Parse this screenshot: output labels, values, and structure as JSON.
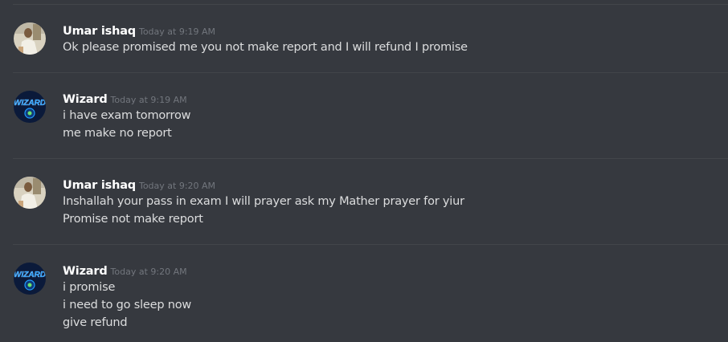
{
  "messages": [
    {
      "author": "Umar ishaq",
      "avatar_icon": "user-photo-avatar",
      "time": "Today at 9:19 AM",
      "lines": [
        "Ok please promised me you not make report and I will refund I promise"
      ]
    },
    {
      "author": "Wizard",
      "avatar_icon": "wizard-logo-avatar",
      "time": "Today at 9:19 AM",
      "lines": [
        "i have exam tomorrow",
        "me make no report"
      ]
    },
    {
      "author": "Umar ishaq",
      "avatar_icon": "user-photo-avatar",
      "time": "Today at 9:20 AM",
      "lines": [
        "Inshallah your pass in exam I will prayer ask my Mather prayer for yiur",
        "Promise not make report"
      ]
    },
    {
      "author": "Wizard",
      "avatar_icon": "wizard-logo-avatar",
      "time": "Today at 9:20 AM",
      "lines": [
        "i promise",
        "i need to go sleep now",
        "give refund"
      ]
    }
  ],
  "colors": {
    "background": "#36393f",
    "divider": "#42454a",
    "username": "#ffffff",
    "timestamp": "#72767d",
    "text": "#dcddde",
    "wizard_avatar_bg": "#0b1a3a",
    "wizard_avatar_accent": "#1e9bff",
    "umar_avatar_bg": "#d9d2c0"
  }
}
